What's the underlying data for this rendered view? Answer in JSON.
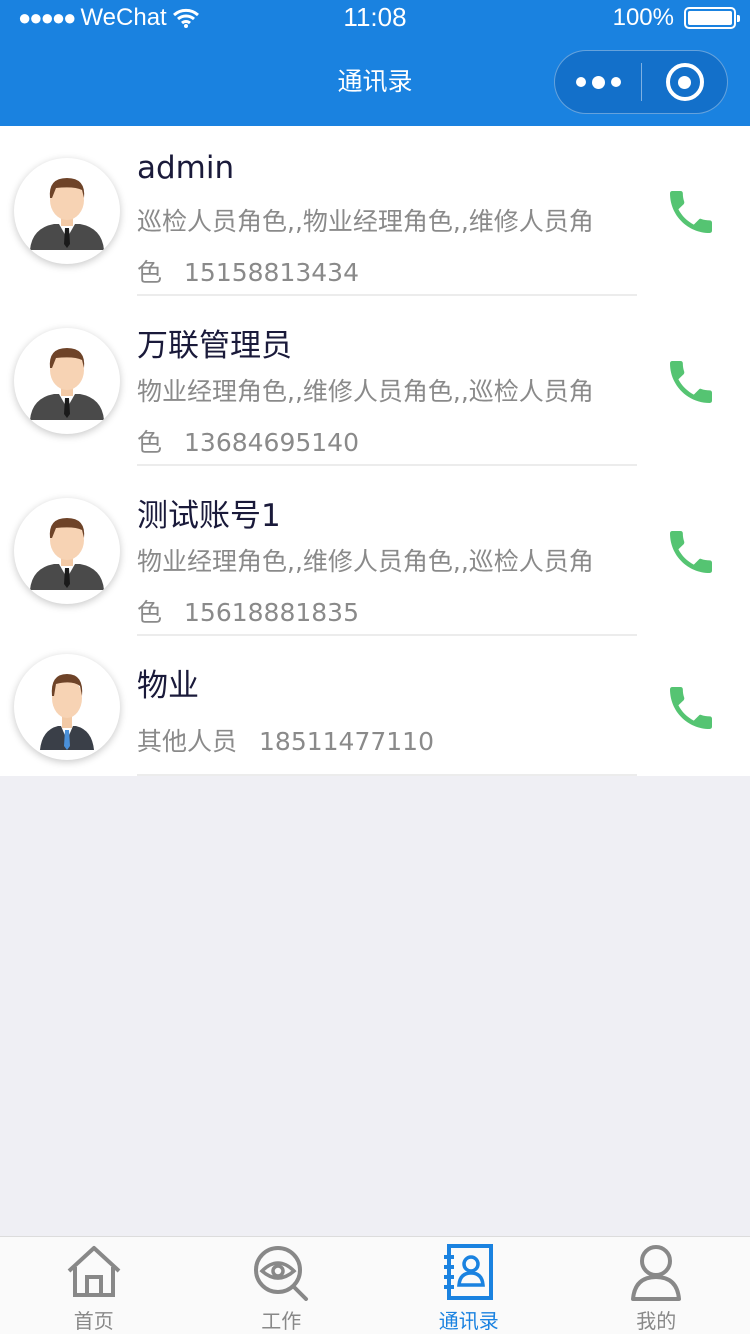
{
  "status_bar": {
    "carrier": "WeChat",
    "time": "11:08",
    "battery": "100%"
  },
  "nav": {
    "title": "通讯录"
  },
  "contacts": [
    {
      "name": "admin",
      "roles": "巡检人员角色,,物业经理角色,,维修人员角色",
      "phone": "15158813434",
      "avatar_style": "suit"
    },
    {
      "name": "万联管理员",
      "roles": "物业经理角色,,维修人员角色,,巡检人员角色",
      "phone": "13684695140",
      "avatar_style": "suit"
    },
    {
      "name": "测试账号1",
      "roles": "物业经理角色,,维修人员角色,,巡检人员角色",
      "phone": "15618881835",
      "avatar_style": "suit"
    },
    {
      "name": "物业",
      "roles": "其他人员",
      "phone": "18511477110",
      "avatar_style": "business"
    }
  ],
  "tabbar": {
    "tabs": [
      {
        "label": "首页",
        "icon": "home-icon",
        "active": false
      },
      {
        "label": "工作",
        "icon": "eye-search-icon",
        "active": false
      },
      {
        "label": "通讯录",
        "icon": "contacts-book-icon",
        "active": true
      },
      {
        "label": "我的",
        "icon": "user-icon",
        "active": false
      }
    ]
  },
  "colors": {
    "header": "#1a82e0",
    "call_icon": "#55c472",
    "tab_active": "#1a82e0",
    "tab_inactive": "#888888"
  }
}
